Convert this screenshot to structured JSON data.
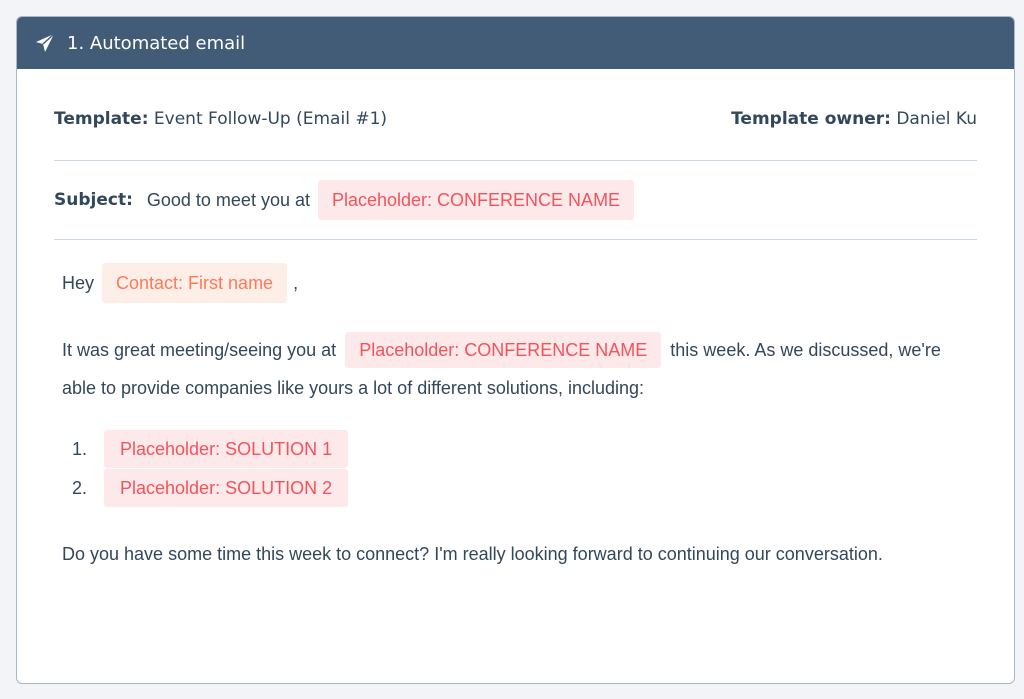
{
  "header": {
    "title": "1. Automated email",
    "icon": "paper-plane-icon",
    "bg_color": "#425b76"
  },
  "meta": {
    "template_label": "Template:",
    "template_value": "Event Follow-Up (Email #1)",
    "owner_label": "Template owner:",
    "owner_value": "Daniel Ku"
  },
  "subject": {
    "label": "Subject:",
    "text": "Good to meet you at",
    "token": "Placeholder: CONFERENCE NAME"
  },
  "body": {
    "greeting": "Hey",
    "greeting_token": "Contact: First name",
    "greeting_suffix": ",",
    "para1_before": "It was great meeting/seeing you at",
    "para1_token": "Placeholder: CONFERENCE NAME",
    "para1_after": "this week. As we discussed, we're able to provide companies like yours a lot of different solutions, including:",
    "solutions": [
      {
        "num": "1.",
        "token": "Placeholder: SOLUTION 1"
      },
      {
        "num": "2.",
        "token": "Placeholder: SOLUTION 2"
      }
    ],
    "para2": "Do you have some time this week to connect? I'm really looking forward to continuing our conversation."
  },
  "colors": {
    "placeholder_bg": "#fde8ea",
    "placeholder_text": "#f2545b",
    "contact_bg": "#fdeee8",
    "contact_text": "#ff7a59"
  }
}
